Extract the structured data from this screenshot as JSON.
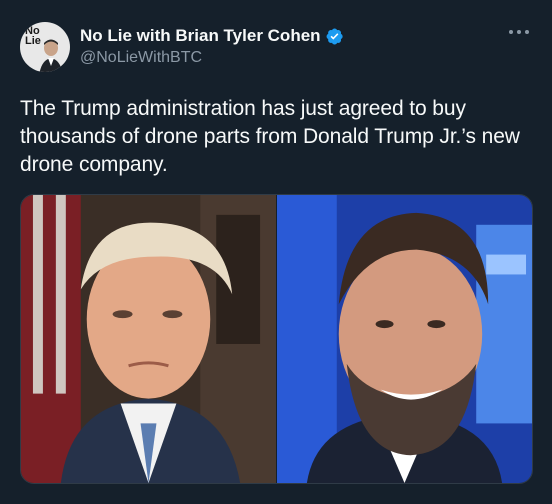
{
  "account": {
    "display_name": "No Lie with Brian Tyler Cohen",
    "handle": "@NoLieWithBTC",
    "avatar_text_line1": "No",
    "avatar_text_line2": "Lie",
    "verified": true
  },
  "tweet": {
    "text": "The Trump administration has just agreed to buy thousands of drone parts from Donald Trump Jr.’s new drone company."
  },
  "media": {
    "images": [
      {
        "icon": "portrait-photo-left"
      },
      {
        "icon": "portrait-photo-right"
      }
    ]
  },
  "colors": {
    "background": "#15202b",
    "text": "#f7f9f9",
    "secondary_text": "#8b98a5",
    "verified": "#1d9bf0"
  }
}
